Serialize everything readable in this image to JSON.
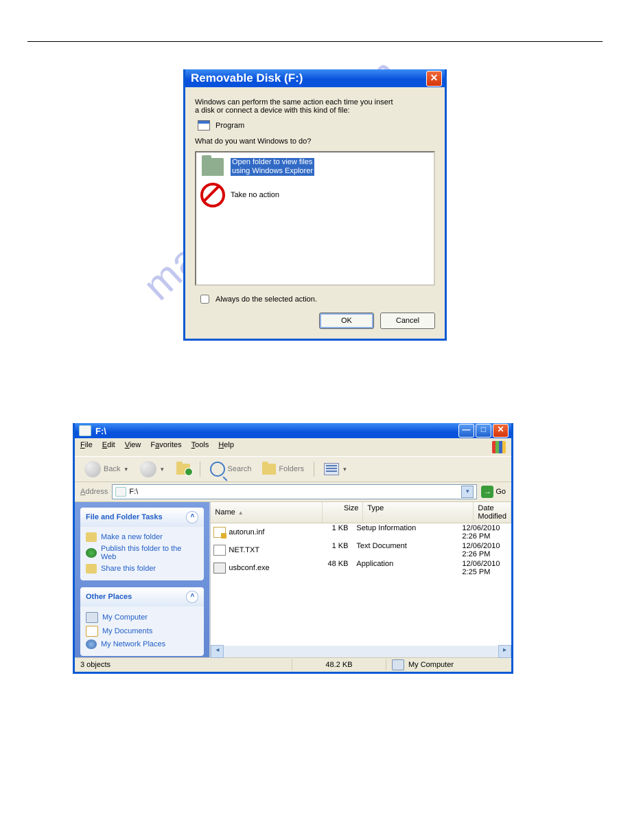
{
  "watermark": "manualshive.com",
  "dialog": {
    "title": "Removable Disk (F:)",
    "intro_line1": "Windows can perform the same action each time you insert",
    "intro_line2": "a disk or connect a device with this kind of file:",
    "row_label": "Program",
    "prompt": "What do you want Windows to do?",
    "item_selected_line1": "Open folder to view files",
    "item_selected_line2": "using Windows Explorer",
    "item2": "Take no action",
    "checkbox_label": "Always do the selected action.",
    "ok": "OK",
    "cancel": "Cancel"
  },
  "explorer": {
    "title": "F:\\",
    "menu": {
      "file": "File",
      "edit": "Edit",
      "view": "View",
      "favorites": "Favorites",
      "tools": "Tools",
      "help": "Help"
    },
    "toolbar": {
      "back": "Back",
      "search": "Search",
      "folders": "Folders"
    },
    "address_label": "Address",
    "address_value": "F:\\",
    "go": "Go",
    "sidebar": {
      "tasks_title": "File and Folder Tasks",
      "tasks": {
        "make_folder": "Make a new folder",
        "publish": "Publish this folder to the Web",
        "share": "Share this folder"
      },
      "other_title": "Other Places",
      "other": {
        "mycomputer": "My Computer",
        "mydocs": "My Documents",
        "mynetwork": "My Network Places"
      }
    },
    "columns": {
      "name": "Name",
      "size": "Size",
      "type": "Type",
      "date": "Date Modified"
    },
    "files": [
      {
        "name": "autorun.inf",
        "size": "1 KB",
        "type": "Setup Information",
        "date": "12/06/2010 2:26 PM"
      },
      {
        "name": "NET.TXT",
        "size": "1 KB",
        "type": "Text Document",
        "date": "12/06/2010 2:26 PM"
      },
      {
        "name": "usbconf.exe",
        "size": "48 KB",
        "type": "Application",
        "date": "12/06/2010 2:25 PM"
      }
    ],
    "status": {
      "objects": "3 objects",
      "size": "48.2 KB",
      "location": "My Computer"
    }
  }
}
